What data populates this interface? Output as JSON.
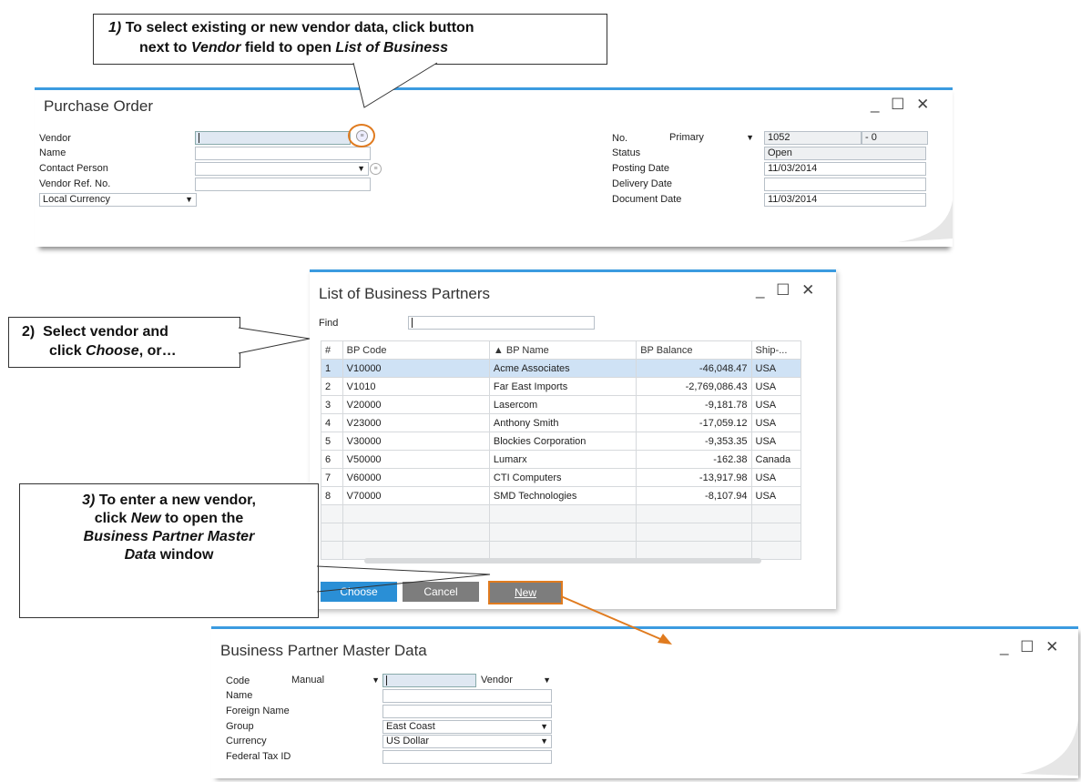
{
  "callouts": {
    "one": {
      "num": "1)",
      "text_a": "To select existing or new vendor data, click button",
      "text_b_pre": "next to ",
      "text_b_em": "Vendor",
      "text_b_mid": " field to open ",
      "text_b_em2": "List of Business"
    },
    "two": {
      "num": "2)",
      "line1": "Select vendor and",
      "line2_pre": "click ",
      "line2_em": "Choose",
      "line2_post": ", or…"
    },
    "three": {
      "num": "3)",
      "line1": "To enter a new vendor,",
      "line2_pre": "click ",
      "line2_em": "New",
      "line2_post": " to open the",
      "line3": "Business Partner Master",
      "line4_em": "Data",
      "line4_post": " window"
    }
  },
  "purchase_order": {
    "title": "Purchase Order",
    "window_controls": "_ ☐ ✕",
    "left_labels": {
      "vendor": "Vendor",
      "name": "Name",
      "contact": "Contact Person",
      "ref": "Vendor Ref. No."
    },
    "currency_option": "Local Currency",
    "right_labels": {
      "no": "No.",
      "status": "Status",
      "posting": "Posting Date",
      "delivery": "Delivery Date",
      "document": "Document Date"
    },
    "series": "Primary",
    "number": "1052",
    "suffix": "- 0",
    "status": "Open",
    "posting_date": "11/03/2014",
    "delivery_date": "",
    "document_date": "11/03/2014"
  },
  "bp_list": {
    "title": "List of Business Partners",
    "window_controls": "_ ☐ ✕",
    "find_label": "Find",
    "columns": [
      "#",
      "BP Code",
      "BP Name",
      "BP Balance",
      "Ship-..."
    ],
    "rows": [
      {
        "n": "1",
        "code": "V10000",
        "name": "Acme Associates",
        "balance": "-46,048.47",
        "ship": "USA"
      },
      {
        "n": "2",
        "code": "V1010",
        "name": "Far East Imports",
        "balance": "-2,769,086.43",
        "ship": "USA"
      },
      {
        "n": "3",
        "code": "V20000",
        "name": "Lasercom",
        "balance": "-9,181.78",
        "ship": "USA"
      },
      {
        "n": "4",
        "code": "V23000",
        "name": "Anthony Smith",
        "balance": "-17,059.12",
        "ship": "USA"
      },
      {
        "n": "5",
        "code": "V30000",
        "name": "Blockies Corporation",
        "balance": "-9,353.35",
        "ship": "USA"
      },
      {
        "n": "6",
        "code": "V50000",
        "name": "Lumarx",
        "balance": "-162.38",
        "ship": "Canada"
      },
      {
        "n": "7",
        "code": "V60000",
        "name": "CTI Computers",
        "balance": "-13,917.98",
        "ship": "USA"
      },
      {
        "n": "8",
        "code": "V70000",
        "name": "SMD Technologies",
        "balance": "-8,107.94",
        "ship": "USA"
      }
    ],
    "buttons": {
      "choose": "Choose",
      "cancel": "Cancel",
      "new": "New"
    }
  },
  "bp_master": {
    "title": "Business Partner Master Data",
    "window_controls": "_ ☐ ✕",
    "labels": {
      "code": "Code",
      "name": "Name",
      "foreign": "Foreign Name",
      "group": "Group",
      "currency": "Currency",
      "tax": "Federal Tax ID"
    },
    "code_mode": "Manual",
    "type": "Vendor",
    "group": "East Coast",
    "currency": "US Dollar"
  },
  "colors": {
    "accent": "#3b9be0",
    "highlight": "#e07b1f",
    "grid_selected": "#cfe2f5",
    "button_blue": "#2a8fd6",
    "button_gray": "#7d7d7d"
  }
}
